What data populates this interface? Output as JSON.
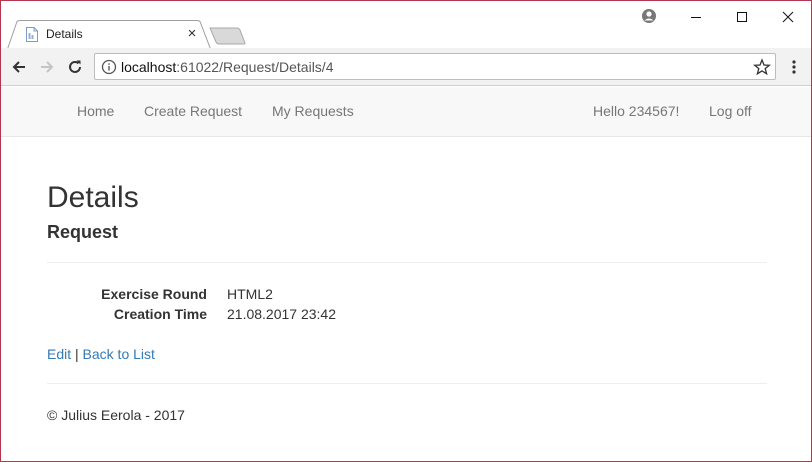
{
  "browser": {
    "tab_title": "Details",
    "tab_close_glyph": "×",
    "url_host": "localhost",
    "url_path": ":61022/Request/Details/4"
  },
  "navbar": {
    "links": [
      "Home",
      "Create Request",
      "My Requests"
    ],
    "greeting": "Hello 234567!",
    "logoff": "Log off"
  },
  "page": {
    "title": "Details",
    "subtitle": "Request",
    "fields": [
      {
        "term": "Exercise Round",
        "value": "HTML2"
      },
      {
        "term": "Creation Time",
        "value": "21.08.2017 23:42"
      }
    ],
    "edit_link": "Edit",
    "separator": "|",
    "back_link": "Back to List",
    "footer": "© Julius Eerola - 2017"
  },
  "colors": {
    "window_border": "#b3354f",
    "link": "#337ab7",
    "nav_text": "#777777",
    "navbar_bg": "#f8f8f8",
    "text": "#333333"
  },
  "icons": [
    "page-favicon-icon",
    "close-icon",
    "profile-icon",
    "minimize-icon",
    "maximize-icon",
    "window-close-icon",
    "back-arrow-icon",
    "forward-arrow-icon",
    "reload-icon",
    "info-icon",
    "star-icon",
    "menu-dots-icon"
  ]
}
